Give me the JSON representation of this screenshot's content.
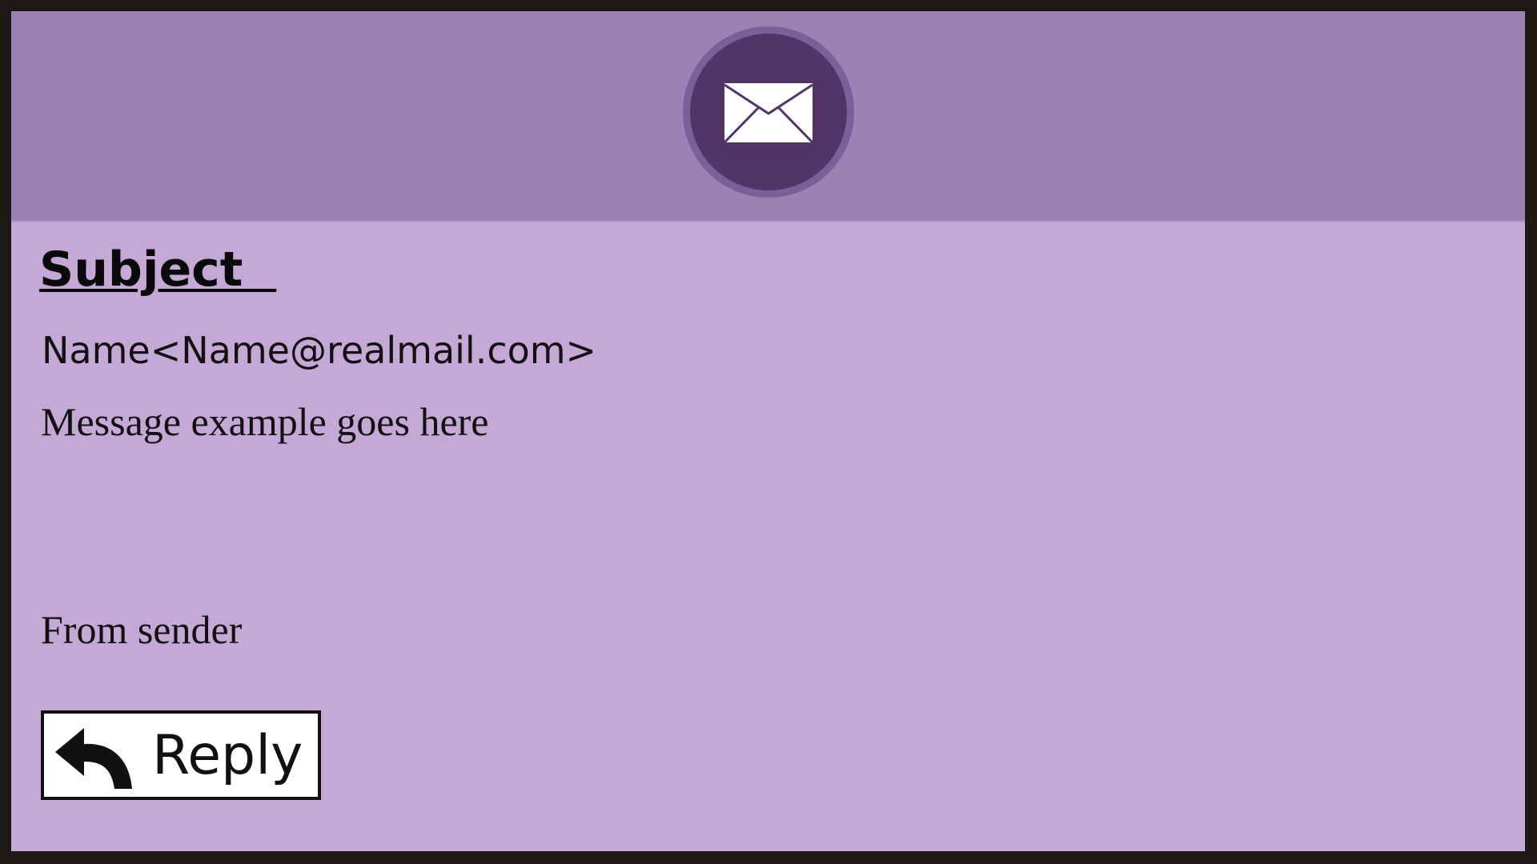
{
  "header": {
    "icon": "mail-envelope-icon"
  },
  "email": {
    "subject": "Subject  ",
    "sender": "Name<Name@realmail.com>",
    "message": "Message example goes here",
    "signature": "From sender"
  },
  "actions": {
    "reply_icon": "reply-arrow-icon",
    "reply_label": "Reply"
  },
  "colors": {
    "header_bg": "#9c81b4",
    "body_bg": "#c4a9d7",
    "badge": "#523468",
    "frame": "#1c1915"
  }
}
